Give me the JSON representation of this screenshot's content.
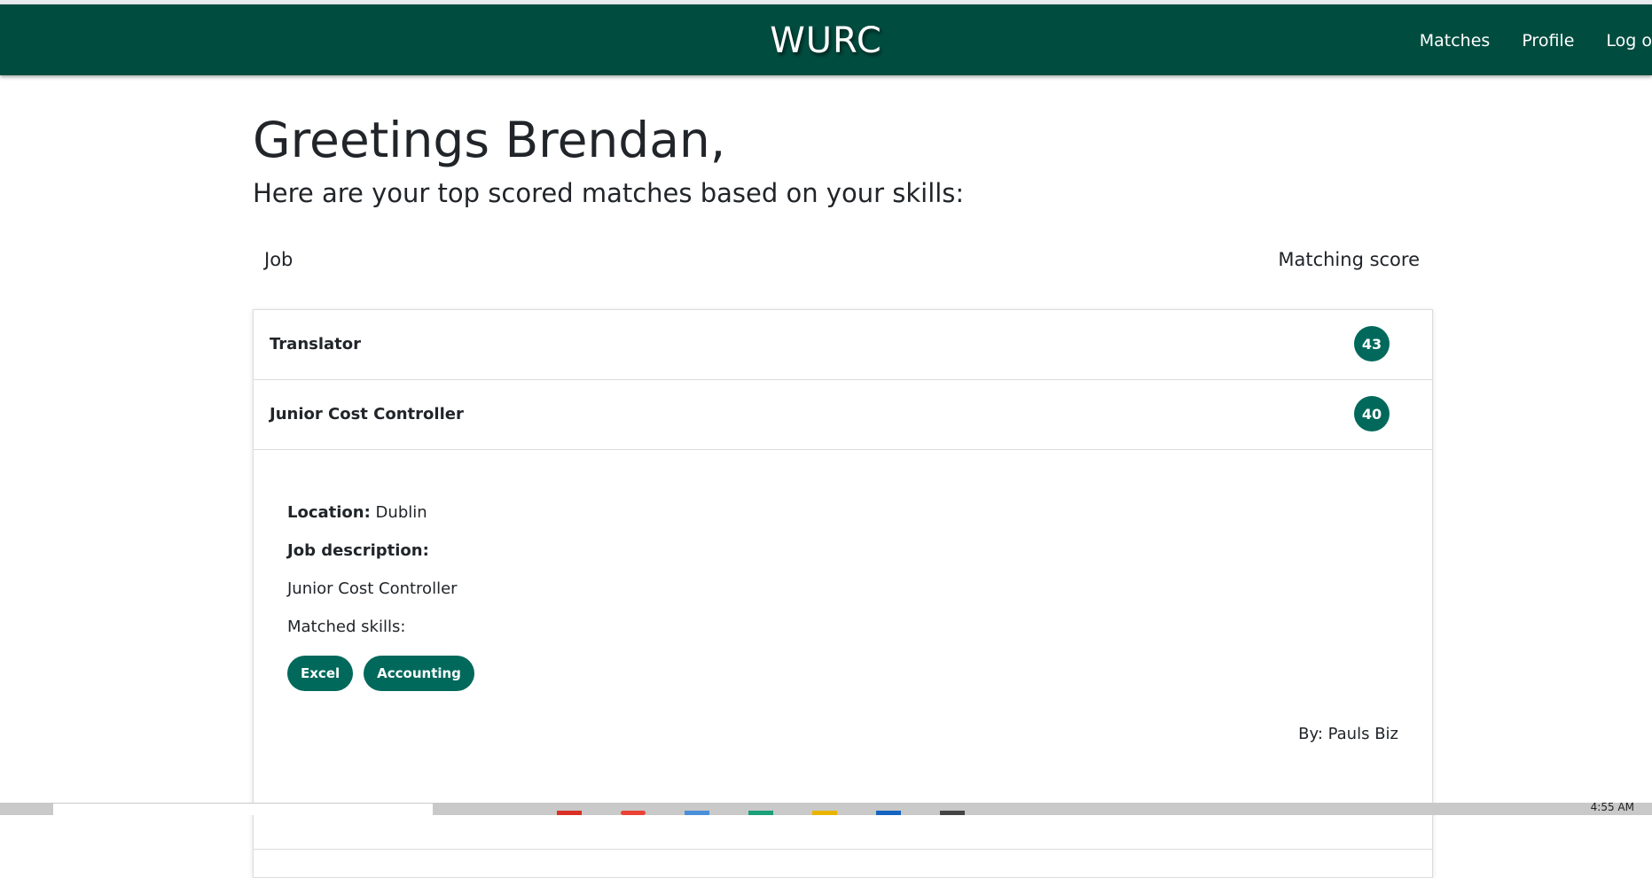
{
  "navbar": {
    "brand": "WURC",
    "links": [
      "Matches",
      "Profile",
      "Log o"
    ]
  },
  "page": {
    "greeting": "Greetings Brendan,",
    "subtitle": "Here are your top scored matches based on your skills:"
  },
  "table": {
    "header_job": "Job",
    "header_score": "Matching score",
    "rows": [
      {
        "title": "Translator",
        "score": "43"
      },
      {
        "title": "Junior Cost Controller",
        "score": "40"
      }
    ]
  },
  "details": {
    "location_label": "Location:",
    "location_value": "Dublin",
    "description_label": "Job description:",
    "description_text": "Junior Cost Controller",
    "matched_skills_label": "Matched skills:",
    "skills": [
      "Excel",
      "Accounting"
    ],
    "by": "By: Pauls Biz"
  },
  "taskbar": {
    "time": "4:55 AM"
  },
  "colors": {
    "navbar": "#004d40",
    "accent": "#00695c"
  }
}
